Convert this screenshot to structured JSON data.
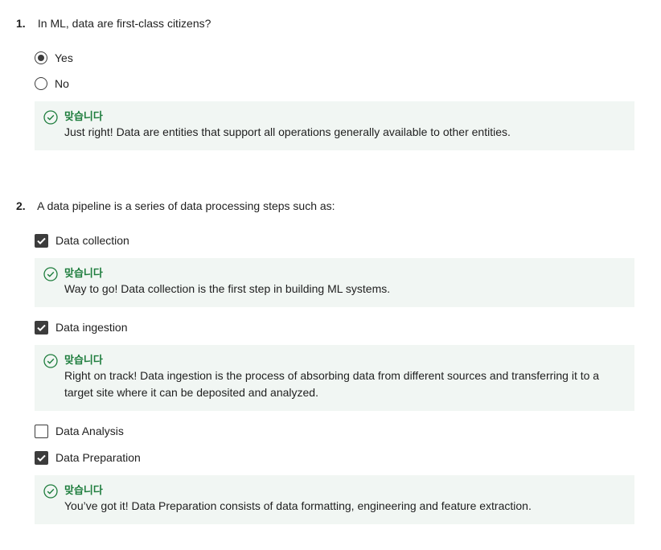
{
  "questions": [
    {
      "number": "1.",
      "text": "In ML, data are first-class citizens?",
      "options": [
        {
          "label": "Yes",
          "selected": true
        },
        {
          "label": "No",
          "selected": false
        }
      ],
      "feedback": {
        "title": "맞습니다",
        "text": "Just right! Data are entities that support all operations generally available to other entities."
      }
    },
    {
      "number": "2.",
      "text": "A data pipeline is a series of data processing steps such as:",
      "options": [
        {
          "label": "Data collection",
          "checked": true,
          "feedback": {
            "title": "맞습니다",
            "text": "Way to go! Data collection is the first step in building ML systems."
          }
        },
        {
          "label": "Data ingestion",
          "checked": true,
          "feedback": {
            "title": "맞습니다",
            "text": "Right on track! Data ingestion is the process of absorbing data from different sources and transferring it to a target site where it can be deposited and analyzed."
          }
        },
        {
          "label": "Data Analysis",
          "checked": false
        },
        {
          "label": "Data Preparation",
          "checked": true,
          "feedback": {
            "title": "맞습니다",
            "text": "You’ve got it! Data Preparation consists of data formatting, engineering and feature extraction."
          }
        }
      ]
    }
  ],
  "colors": {
    "success": "#1e7d3d",
    "feedback_bg": "#f1f6f3",
    "control": "#3c3c3c"
  },
  "icons": {
    "radio": "radio-button",
    "checkbox": "checkbox",
    "feedback": "check-circle-icon"
  }
}
